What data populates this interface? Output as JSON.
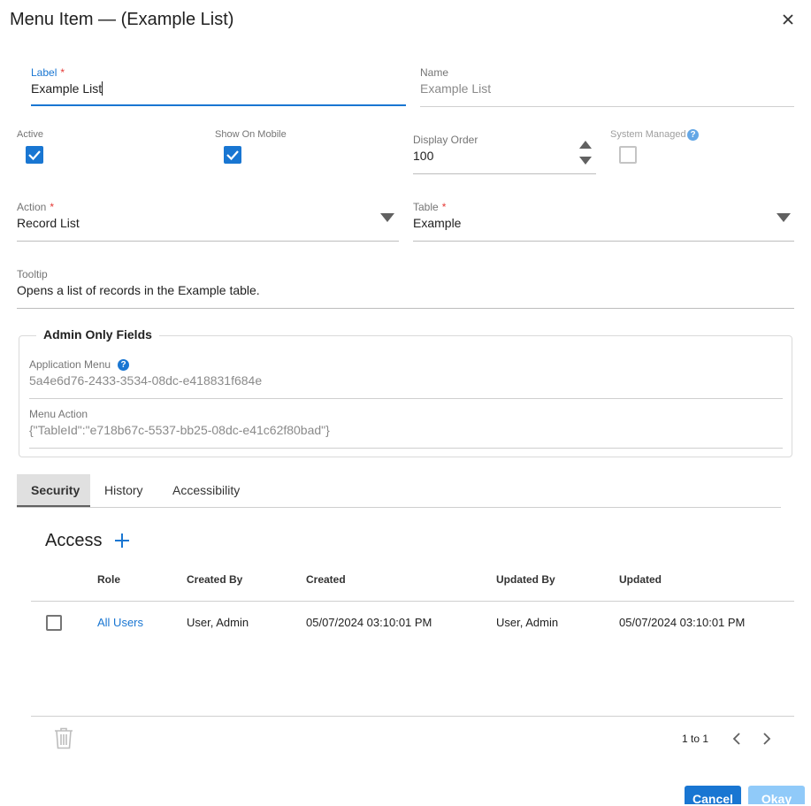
{
  "dialog": {
    "title": "Menu Item — (Example List)"
  },
  "form": {
    "label": {
      "label": "Label",
      "required_mark": "*",
      "value": "Example List"
    },
    "name": {
      "label": "Name",
      "value": "Example List"
    },
    "active": {
      "label": "Active",
      "checked": true
    },
    "show_on_mobile": {
      "label": "Show On Mobile",
      "checked": true
    },
    "display_order": {
      "label": "Display Order",
      "value": "100"
    },
    "system_managed": {
      "label": "System Managed",
      "checked": false
    },
    "action": {
      "label": "Action",
      "required_mark": "*",
      "value": "Record List"
    },
    "table": {
      "label": "Table",
      "required_mark": "*",
      "value": "Example"
    },
    "tooltip": {
      "label": "Tooltip",
      "value": "Opens a list of records in the Example table."
    }
  },
  "admin": {
    "legend": "Admin Only Fields",
    "application_menu": {
      "label": "Application Menu",
      "value": "5a4e6d76-2433-3534-08dc-e418831f684e"
    },
    "menu_action": {
      "label": "Menu Action",
      "value": "{\"TableId\":\"e718b67c-5537-bb25-08dc-e41c62f80bad\"}"
    }
  },
  "tabs": [
    {
      "label": "Security",
      "active": true
    },
    {
      "label": "History",
      "active": false
    },
    {
      "label": "Accessibility",
      "active": false
    }
  ],
  "access": {
    "heading": "Access",
    "columns": [
      "Role",
      "Created By",
      "Created",
      "Updated By",
      "Updated"
    ],
    "rows": [
      {
        "role": "All Users",
        "created_by": "User, Admin",
        "created": "05/07/2024 03:10:01 PM",
        "updated_by": "User, Admin",
        "updated": "05/07/2024 03:10:01 PM"
      }
    ],
    "pagination": "1 to 1"
  },
  "footer": {
    "cancel": "Cancel",
    "okay": "Okay"
  },
  "colors": {
    "primary": "#1976d2",
    "required": "#e53935",
    "disabled_primary": "#90caf9"
  },
  "icons": [
    "close-icon",
    "plus-icon",
    "help-icon",
    "trash-icon",
    "chevron-left-icon",
    "chevron-right-icon",
    "dropdown-arrow-icon",
    "spinner-up-icon",
    "spinner-down-icon",
    "check-icon"
  ]
}
